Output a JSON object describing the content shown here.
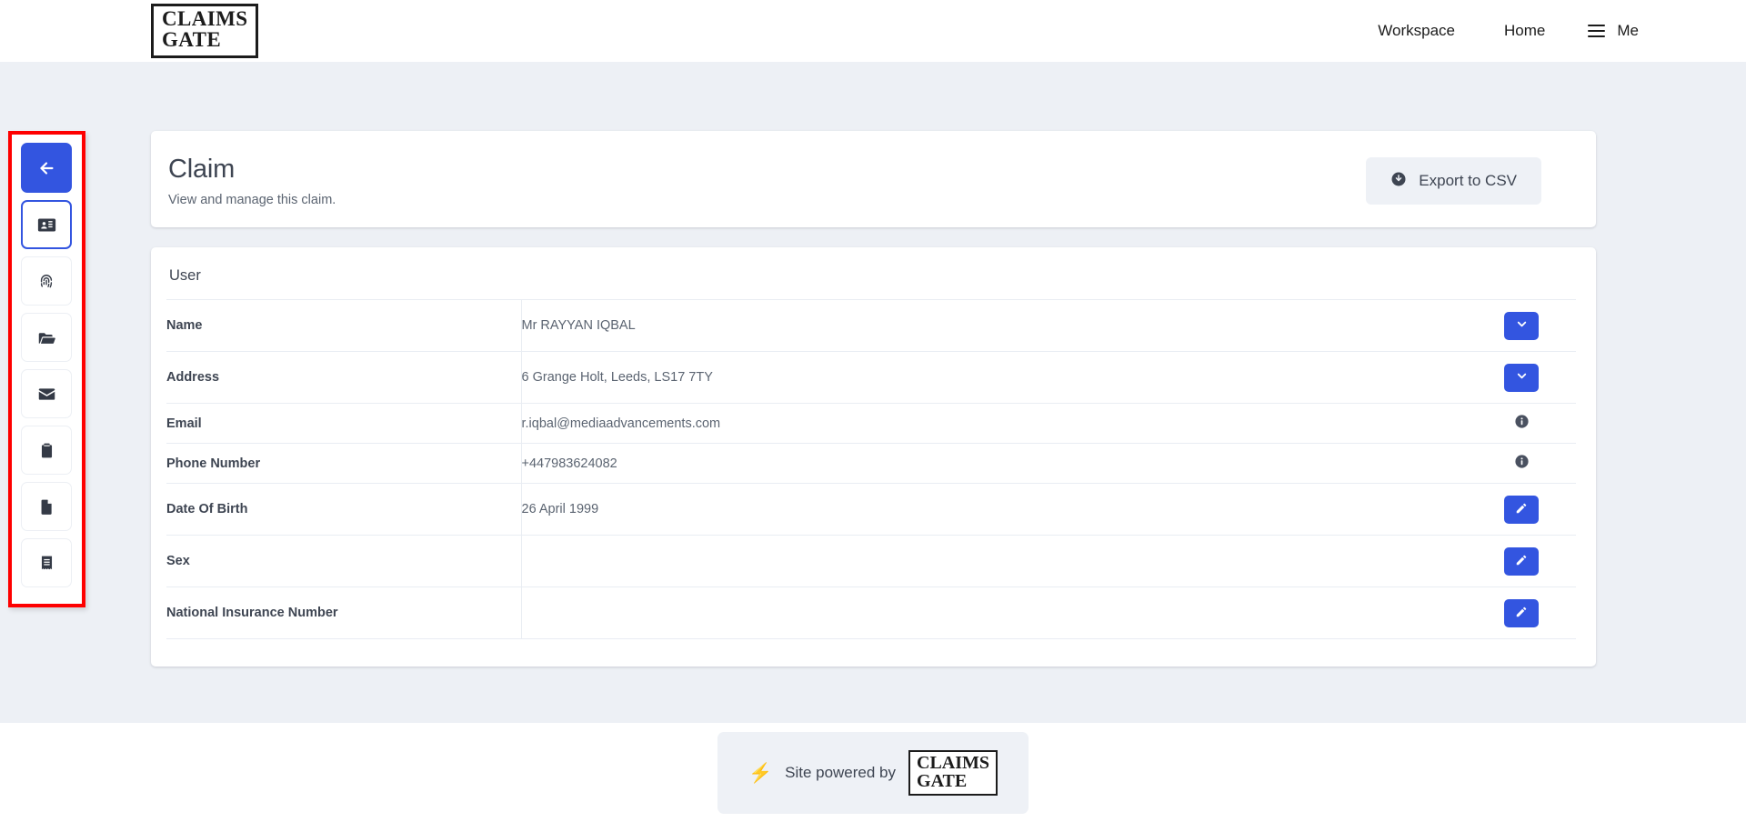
{
  "header": {
    "logo_line1": "CLAIMS",
    "logo_line2": "GATE",
    "nav": [
      {
        "label": "Workspace",
        "name": "nav-workspace"
      },
      {
        "label": "Home",
        "name": "nav-home"
      }
    ],
    "me_label": "Me",
    "menu_icon": "hamburger-icon"
  },
  "sidebar": {
    "items": [
      {
        "name": "sidebar-back-button",
        "icon": "arrow-left-icon",
        "state": "primary"
      },
      {
        "name": "sidebar-item-user-details",
        "icon": "id-card-icon",
        "state": "active"
      },
      {
        "name": "sidebar-item-identity",
        "icon": "fingerprint-icon",
        "state": "default"
      },
      {
        "name": "sidebar-item-files",
        "icon": "folder-open-icon",
        "state": "default"
      },
      {
        "name": "sidebar-item-messages",
        "icon": "envelope-icon",
        "state": "default"
      },
      {
        "name": "sidebar-item-tasks",
        "icon": "clipboard-icon",
        "state": "default"
      },
      {
        "name": "sidebar-item-documents",
        "icon": "file-icon",
        "state": "default"
      },
      {
        "name": "sidebar-item-invoices",
        "icon": "receipt-icon",
        "state": "default"
      }
    ]
  },
  "main": {
    "title": "Claim",
    "subtitle": "View and manage this claim.",
    "export_label": "Export to CSV",
    "export_icon": "download-circle-icon",
    "section_title": "User",
    "rows": [
      {
        "label": "Name",
        "value": "Mr RAYYAN IQBAL",
        "action": "chevron-down",
        "height": "tall"
      },
      {
        "label": "Address",
        "value": "6 Grange Holt, Leeds, LS17 7TY",
        "action": "chevron-down",
        "height": "tall"
      },
      {
        "label": "Email",
        "value": "r.iqbal@mediaadvancements.com",
        "action": "info",
        "height": "short"
      },
      {
        "label": "Phone Number",
        "value": "+447983624082",
        "action": "info",
        "height": "short"
      },
      {
        "label": "Date Of Birth",
        "value": "26 April 1999",
        "action": "edit",
        "height": "tall"
      },
      {
        "label": "Sex",
        "value": "",
        "action": "edit",
        "height": "tall"
      },
      {
        "label": "National Insurance Number",
        "value": "",
        "action": "edit",
        "height": "tall"
      }
    ]
  },
  "footer": {
    "bolt_icon": "lightning-bolt-icon",
    "powered_text": "Site powered by",
    "logo_line1": "CLAIMS",
    "logo_line2": "GATE"
  },
  "colors": {
    "primary_blue": "#3355e0",
    "annotation_red": "#fe0000",
    "page_background": "#edf0f5",
    "text_dark": "#3e4552",
    "text_muted": "#5b6471",
    "info_icon": "#4a5160",
    "bolt_orange": "#f97316"
  }
}
